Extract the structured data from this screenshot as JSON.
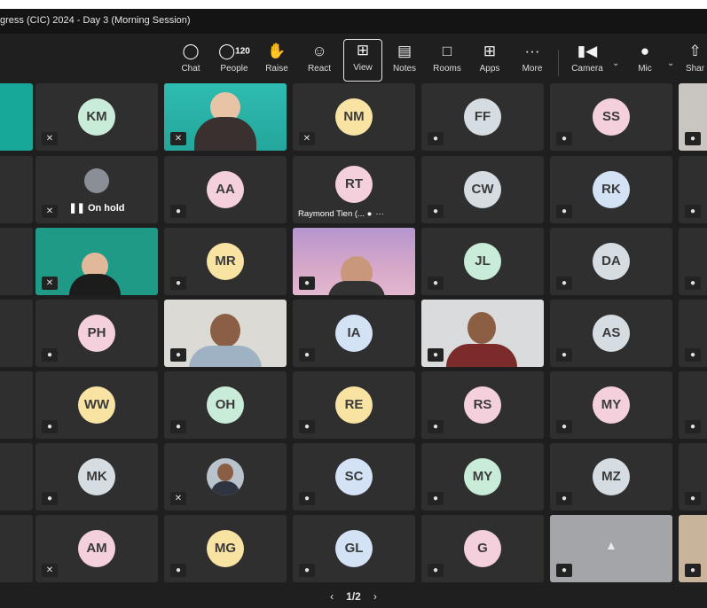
{
  "window": {
    "title": "gress (CIC) 2024 - Day 3 (Morning Session)"
  },
  "toolbar": {
    "chat": {
      "label": "Chat",
      "icon": "chat-icon"
    },
    "people": {
      "label": "People",
      "count": "120",
      "icon": "people-icon"
    },
    "raise": {
      "label": "Raise",
      "icon": "raise-hand-icon"
    },
    "react": {
      "label": "React",
      "icon": "smiley-icon"
    },
    "view": {
      "label": "View",
      "icon": "grid-icon",
      "active": true
    },
    "notes": {
      "label": "Notes",
      "icon": "notes-icon"
    },
    "rooms": {
      "label": "Rooms",
      "icon": "rooms-icon"
    },
    "apps": {
      "label": "Apps",
      "icon": "apps-icon"
    },
    "more": {
      "label": "More",
      "icon": "ellipsis-icon"
    },
    "camera": {
      "label": "Camera",
      "icon": "camera-icon"
    },
    "mic": {
      "label": "Mic",
      "icon": "mic-icon"
    },
    "share": {
      "label": "Shar",
      "icon": "share-icon"
    }
  },
  "grid": {
    "row1": {
      "c1": "KM",
      "c3": "NM",
      "c4": "FF",
      "c5": "SS"
    },
    "row2": {
      "c1_status": "On hold",
      "c2": "AA",
      "c3": "RT",
      "c3_name": "Raymond Tien (...",
      "c4": "CW",
      "c5": "RK"
    },
    "row3": {
      "c2": "MR",
      "c4": "JL",
      "c5": "DA"
    },
    "row4": {
      "c1": "PH",
      "c3": "IA",
      "c5": "AS"
    },
    "row5": {
      "c1": "WW",
      "c2": "OH",
      "c3": "RE",
      "c4": "RS",
      "c5": "MY"
    },
    "row6": {
      "c1": "MK",
      "c3": "SC",
      "c4": "MY",
      "c5": "MZ"
    },
    "row7": {
      "c1": "AM",
      "c2": "MG",
      "c3": "GL",
      "c4": "G"
    }
  },
  "colors": {
    "bg": "#1f1f1f",
    "tile": "#2f2f2f",
    "avatar_green": "#c9ecd8",
    "avatar_yellow": "#f8e3a3",
    "avatar_pink": "#f3d0dc",
    "avatar_blue": "#d4e2f6",
    "avatar_gray": "#d6dde2"
  },
  "pager": {
    "text": "1/2",
    "prev": "‹",
    "next": "›"
  }
}
